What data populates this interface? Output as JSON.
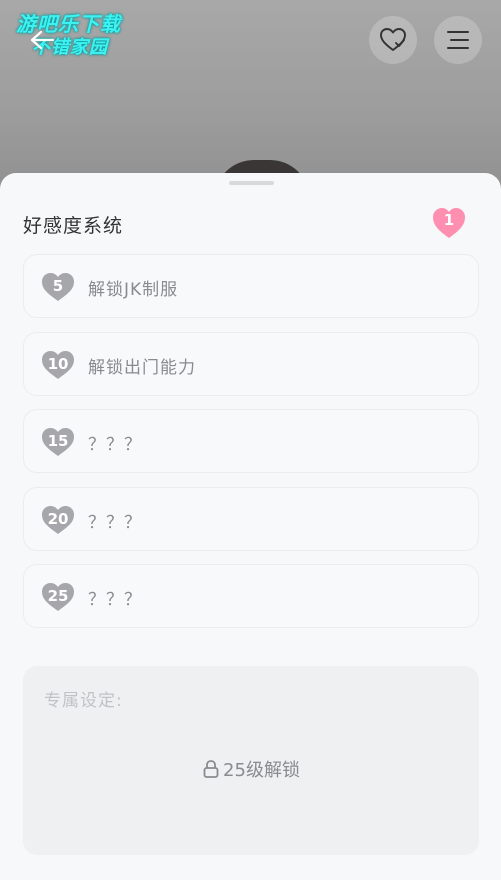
{
  "header": {
    "watermark_line1": "游吧乐下载",
    "watermark_line2": "不错家园",
    "icons": [
      "back-arrow-icon",
      "heart-favorite-icon",
      "menu-icon"
    ]
  },
  "sheet": {
    "title": "好感度系统",
    "current_level": "1",
    "rewards": [
      {
        "level": "5",
        "label": "解锁JK制服"
      },
      {
        "level": "10",
        "label": "解锁出门能力"
      },
      {
        "level": "15",
        "label": "？？？"
      },
      {
        "level": "20",
        "label": "？？？"
      },
      {
        "level": "25",
        "label": "？？？"
      }
    ],
    "exclusive": {
      "title": "专属设定:",
      "unlock_text": "25级解锁"
    }
  },
  "colors": {
    "level_heart": "#ff8fb1",
    "locked_heart": "#a6a6ab",
    "watermark": "#3ff2f2"
  }
}
